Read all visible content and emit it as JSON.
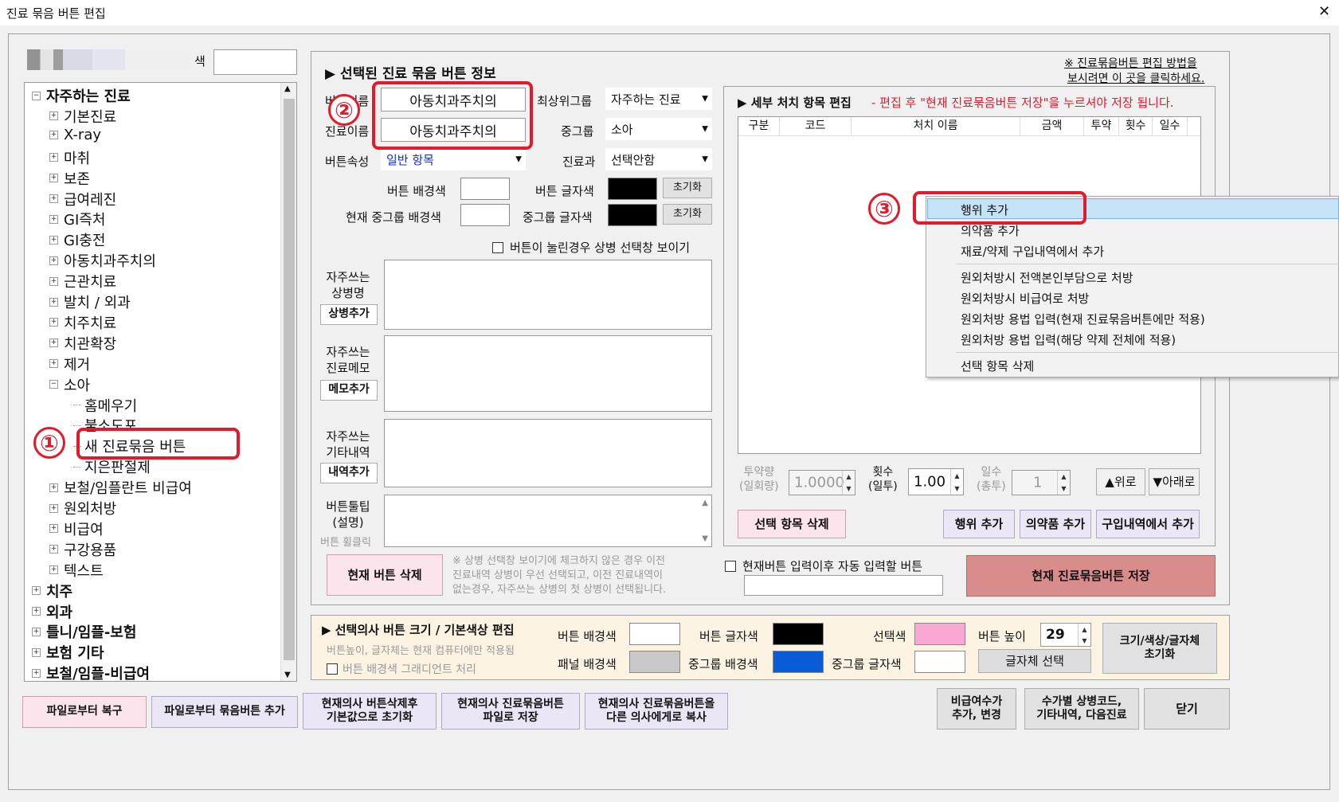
{
  "window": {
    "title": "진료 묶음 버튼 편집",
    "close": "✕"
  },
  "left": {
    "search_label": "색",
    "search_value": "",
    "tree": [
      {
        "label": "자주하는 진료",
        "level": 0,
        "exp": "⊟"
      },
      {
        "label": "기본진료",
        "level": 1,
        "exp": "⊞"
      },
      {
        "label": "X-ray",
        "level": 1,
        "exp": "⊞"
      },
      {
        "label": "마취",
        "level": 1,
        "exp": "⊞"
      },
      {
        "label": "보존",
        "level": 1,
        "exp": "⊞"
      },
      {
        "label": "급여레진",
        "level": 1,
        "exp": "⊞"
      },
      {
        "label": "GI즉처",
        "level": 1,
        "exp": "⊞"
      },
      {
        "label": "GI충전",
        "level": 1,
        "exp": "⊞"
      },
      {
        "label": "아동치과주치의",
        "level": 1,
        "exp": "⊞"
      },
      {
        "label": "근관치료",
        "level": 1,
        "exp": "⊞"
      },
      {
        "label": "발치 / 외과",
        "level": 1,
        "exp": "⊞"
      },
      {
        "label": "치주치료",
        "level": 1,
        "exp": "⊞"
      },
      {
        "label": "치관확장",
        "level": 1,
        "exp": "⊞"
      },
      {
        "label": "제거",
        "level": 1,
        "exp": "⊞"
      },
      {
        "label": "소아",
        "level": 1,
        "exp": "⊟"
      },
      {
        "label": "홈메우기",
        "level": 2,
        "exp": ""
      },
      {
        "label": "불소도포",
        "level": 2,
        "exp": ""
      },
      {
        "label": "새 진료묶음 버튼",
        "level": 2,
        "exp": ""
      },
      {
        "label": "지은판절제",
        "level": 2,
        "exp": ""
      },
      {
        "label": "보철/임플란트 비급여",
        "level": 1,
        "exp": "⊞"
      },
      {
        "label": "원외처방",
        "level": 1,
        "exp": "⊞"
      },
      {
        "label": "비급여",
        "level": 1,
        "exp": "⊞"
      },
      {
        "label": "구강용품",
        "level": 1,
        "exp": "⊞"
      },
      {
        "label": "텍스트",
        "level": 1,
        "exp": "⊞"
      },
      {
        "label": "치주",
        "level": 0,
        "exp": "⊞"
      },
      {
        "label": "외과",
        "level": 0,
        "exp": "⊞"
      },
      {
        "label": "틀니/임플-보험",
        "level": 0,
        "exp": "⊞"
      },
      {
        "label": "보험 기타",
        "level": 0,
        "exp": "⊞"
      },
      {
        "label": "보철/임플-비급여",
        "level": 0,
        "exp": "⊞"
      }
    ]
  },
  "info": {
    "section_title": "▶ 선택된 진료 묶음 버튼 정보",
    "help_link_line1": "※ 진료묶음버튼 편집 방법을",
    "help_link_line2": "보시려면 이 곳을 클릭하세요.",
    "btn_name_label": "버튼이름",
    "btn_name_value": "아동치과주치의",
    "treat_name_label": "진료이름",
    "treat_name_value": "아동치과주치의",
    "top_group_label": "최상위그룹",
    "top_group_value": "자주하는 진료",
    "mid_group_label": "중그룹",
    "mid_group_value": "소아",
    "dept_label": "진료과",
    "dept_value": "선택안함",
    "attr_label": "버튼속성",
    "attr_value": "일반 항목",
    "bg_color_label": "버튼 배경색",
    "fg_color_label": "버튼 글자색",
    "mid_bg_label": "현재 중그룹 배경색",
    "mid_fg_label": "중그룹 글자색",
    "reset": "초기화",
    "show_popup_label": "버튼이 눌린경우 상병 선택창 보이기",
    "freq_diag_label": "자주쓰는\n상병명",
    "freq_diag_btn": "상병추가",
    "freq_memo_label": "자주쓰는\n진료메모",
    "freq_memo_btn": "메모추가",
    "freq_etc_label": "자주쓰는\n기타내역",
    "freq_etc_btn": "내역추가",
    "tooltip_label": "버튼툴팁\n(설명)",
    "tooltip_sub": "버튼 휠클릭",
    "delete_btn": "현재 버튼 삭제",
    "note": "※ 상병 선택창 보이기에 체크하지 않은 경우 이전\n진료내역 상병이 우선 선택되고, 이전 진료내역이\n없는경우, 자주쓰는 상병의 첫 상병이 선택됩니다."
  },
  "detail": {
    "title": "▶ 세부 처치 항목 편집",
    "title_note": "- 편집 후 \"현재 진료묶음버튼 저장\"을 누르셔야 저장 됩니다.",
    "columns": [
      "구분",
      "코드",
      "처치 이름",
      "금액",
      "투약",
      "횟수",
      "일수"
    ],
    "dose_label": "투약량\n(일회량)",
    "dose_value": "1.0000",
    "times_label": "횟수\n(일투)",
    "times_value": "1.00",
    "days_label": "일수\n(총투)",
    "days_value": "1",
    "up_btn": "▲위로",
    "down_btn": "▼아래로",
    "del_item_btn": "선택 항목 삭제",
    "add_action_btn": "행위 추가",
    "add_drug_btn": "의약품 추가",
    "add_purchase_btn": "구입내역에서 추가",
    "auto_next_label": "현재버튼 입력이후 자동 입력할 버튼",
    "auto_next_value": "",
    "save_btn": "현재 진료묶음버튼 저장"
  },
  "context_menu": [
    "행위 추가",
    "의약품 추가",
    "재료/약제 구입내역에서 추가",
    "원외처방시 전액본인부담으로 처방",
    "원외처방시 비급여로 처방",
    "원외처방 용법 입력(현재 진료묶음버튼에만 적용)",
    "원외처방 용법 입력(해당 약제 전체에 적용)",
    "선택 항목 삭제"
  ],
  "size": {
    "title": "▶ 선택의사 버튼 크기 / 기본색상 편집",
    "note": "버튼높이, 글자체는 현재 컴퓨터에만 적용됨",
    "gradient_label": "버튼 배경색 그래디언트 처리",
    "btn_bg_label": "버튼 배경색",
    "btn_fg_label": "버튼 글자색",
    "sel_label": "선택색",
    "height_label": "버튼 높이",
    "height_value": "29",
    "panel_bg_label": "패널 배경색",
    "mid_bg_label": "중그룹 배경색",
    "mid_fg_label": "중그룹 글자색",
    "font_btn": "글자체 선택",
    "reset_btn": "크기/색상/글자체\n초기화"
  },
  "bottom": {
    "restore": "파일로부터 복구",
    "add_from_file": "파일로부터 묶음버튼 추가",
    "reset_default": "현재의사 버튼삭제후\n기본값으로 초기화",
    "save_file": "현재의사 진료묶음버튼\n파일로 저장",
    "copy_to": "현재의사 진료묶음버튼을\n다른 의사에게로 복사",
    "nonins": "비급여수가\n추가, 변경",
    "per_fee": "수가별 상병코드,\n기타내역, 다음진료",
    "close": "닫기"
  },
  "markers": [
    "①",
    "②",
    "③"
  ],
  "colors": {
    "highlight_red": "#e3192c",
    "selected_color": "#f9a8d4",
    "mid_group_bg": "#0a5bd6",
    "panel_bg": "#c8c8c8",
    "menu_highlight": "#c5e3f7"
  }
}
